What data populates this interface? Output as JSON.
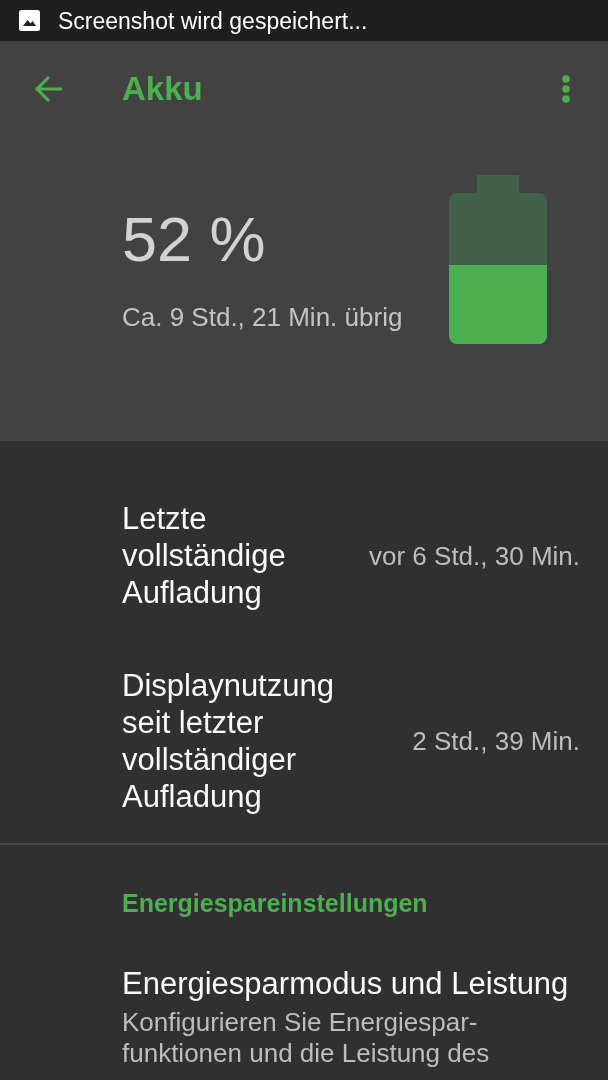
{
  "status_bar": {
    "notification": "Screenshot wird gespeichert..."
  },
  "toolbar": {
    "title": "Akku"
  },
  "battery": {
    "percent": "52 %",
    "remaining": "Ca. 9 Std., 21 Min. übrig",
    "level": 0.52
  },
  "stats": [
    {
      "label": "Letzte vollständige Aufladung",
      "value": "vor 6 Std., 30 Min."
    },
    {
      "label": "Displaynutzung seit letzter vollständiger Aufladung",
      "value": "2 Std., 39 Min."
    }
  ],
  "sections": [
    {
      "header": "Energiespareinstellungen",
      "items": [
        {
          "title": "Energiesparmodus und Leistung",
          "summary": "Konfigurieren Sie Energiespar-funktionen und die Leistung des"
        }
      ]
    }
  ]
}
